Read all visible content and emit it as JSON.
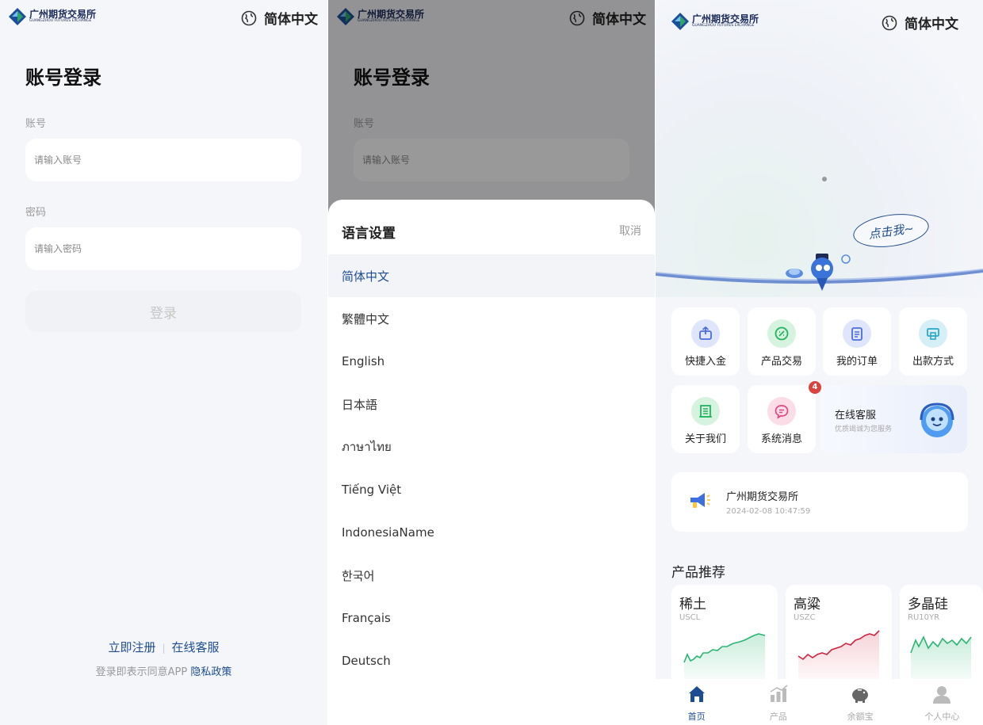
{
  "brand": {
    "cn": "广州期货交易所",
    "en": "GUANGZHOU FUTURES EXCHANGE"
  },
  "current_language": "简体中文",
  "login": {
    "title": "账号登录",
    "account_label": "账号",
    "account_placeholder": "请输入账号",
    "password_label": "密码",
    "password_placeholder": "请输入密码",
    "submit_label": "登录",
    "register_link": "立即注册",
    "support_link": "在线客服",
    "agreement_text": "登录即表示同意APP",
    "privacy_link": "隐私政策"
  },
  "language_sheet": {
    "title": "语言设置",
    "cancel": "取消",
    "options": [
      "简体中文",
      "繁體中文",
      "English",
      "日本語",
      "ภาษาไทย",
      "Tiếng Việt",
      "IndonesiaName",
      "한국어",
      "Français",
      "Deutsch"
    ],
    "selected": "简体中文"
  },
  "home": {
    "mascot_bubble": "点击我~",
    "tiles": [
      {
        "label": "快捷入金",
        "icon": "deposit-icon",
        "color": "#4a6fd8"
      },
      {
        "label": "产品交易",
        "icon": "trade-icon",
        "color": "#22b35e"
      },
      {
        "label": "我的订单",
        "icon": "order-icon",
        "color": "#4a6fd8"
      },
      {
        "label": "出款方式",
        "icon": "withdraw-icon",
        "color": "#29a7c8"
      },
      {
        "label": "关于我们",
        "icon": "about-icon",
        "color": "#22b35e"
      },
      {
        "label": "系统消息",
        "icon": "message-icon",
        "color": "#e0457e",
        "badge": "4"
      }
    ],
    "customer_service": {
      "title": "在线客服",
      "subtitle": "优质竭诚为您服务"
    },
    "news": {
      "title": "广州期货交易所",
      "time": "2024-02-08 10:47:59"
    },
    "products_title": "产品推荐",
    "products": [
      {
        "name": "稀土",
        "code": "USCL",
        "trend": "up",
        "color": "#2bb673"
      },
      {
        "name": "高粱",
        "code": "USZC",
        "trend": "up",
        "color": "#d0243c"
      },
      {
        "name": "多晶硅",
        "code": "RU10YR",
        "trend": "up",
        "color": "#2bb673"
      }
    ],
    "tabbar": [
      {
        "label": "首页",
        "icon": "home-icon",
        "active": true
      },
      {
        "label": "产品",
        "icon": "chart-icon",
        "active": false
      },
      {
        "label": "余额宝",
        "icon": "piggy-bank-icon",
        "active": false
      },
      {
        "label": "个人中心",
        "icon": "user-icon",
        "active": false
      }
    ]
  }
}
